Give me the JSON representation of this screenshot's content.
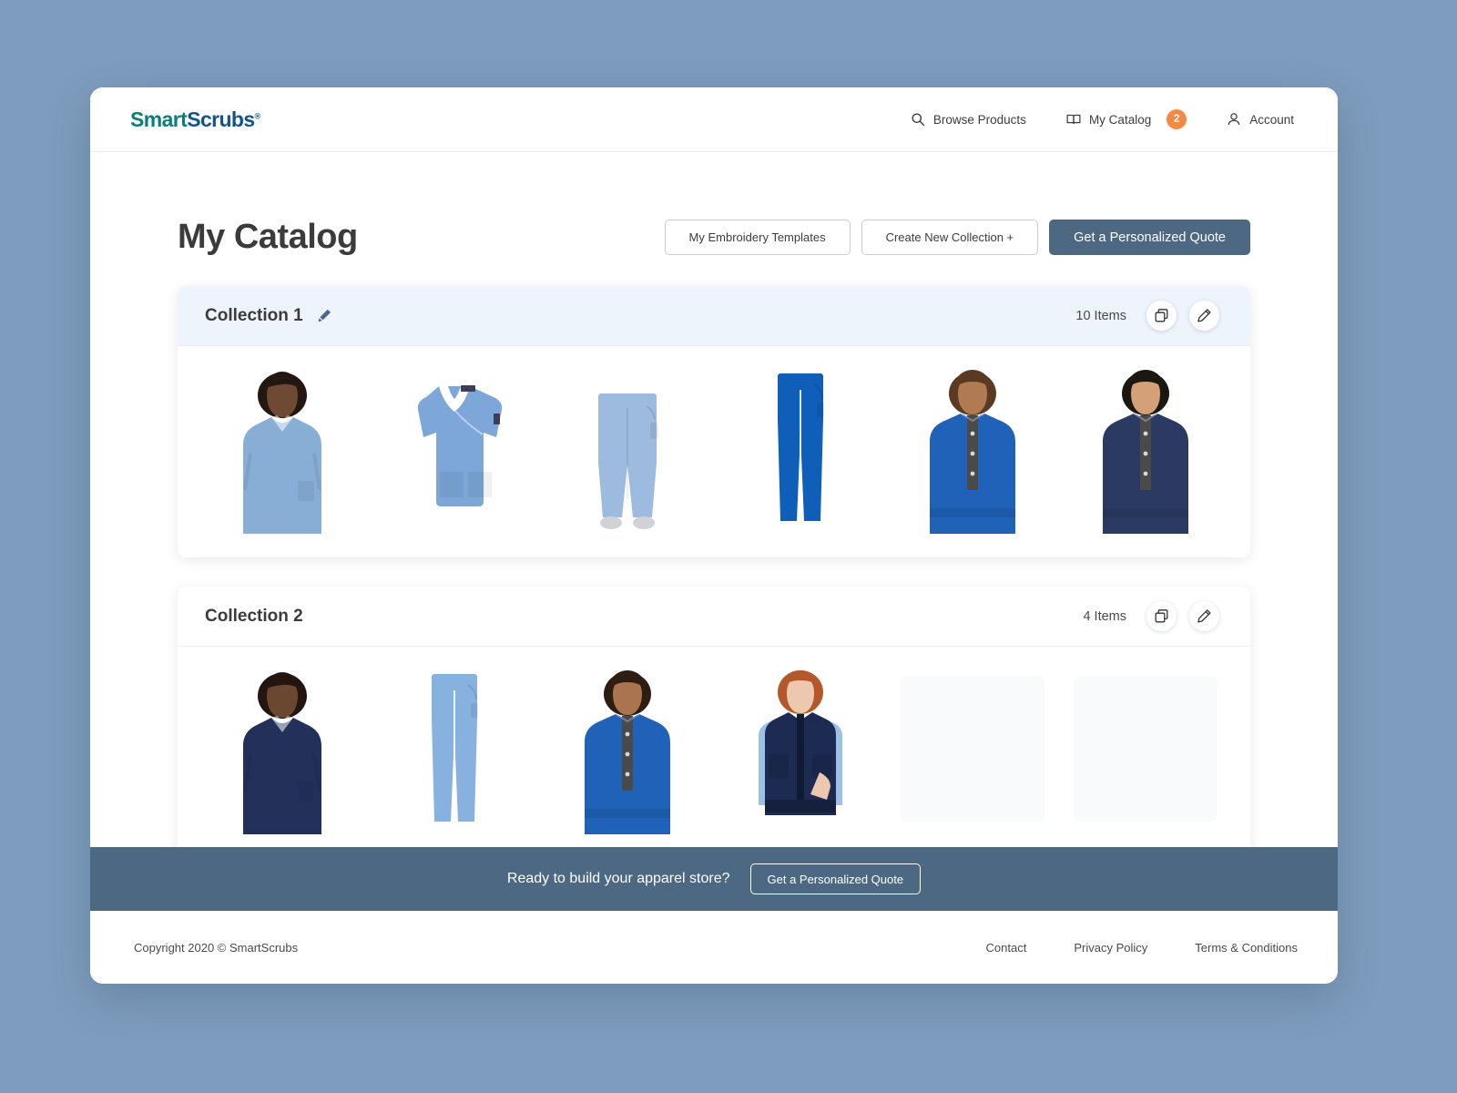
{
  "brand": {
    "name_part1": "Smart",
    "name_part2": "Scrubs",
    "trademark": "®",
    "color_teal": "#0a7f7a",
    "color_blue": "#14528f"
  },
  "nav": {
    "items": [
      {
        "label": "Browse Products",
        "icon": "search-icon"
      },
      {
        "label": "My Catalog",
        "icon": "catalog-icon",
        "badge": "2"
      },
      {
        "label": "Account",
        "icon": "user-icon"
      }
    ]
  },
  "header": {
    "title": "My Catalog",
    "buttons": {
      "embroidery": "My Embroidery Templates",
      "create_collection": "Create New Collection +",
      "quote": "Get a Personalized Quote"
    }
  },
  "collections": [
    {
      "title": "Collection 1",
      "count_label": "10 Items",
      "has_title_edit": true,
      "header_tinted": true,
      "items": [
        {
          "name": "model-ciel-scrub-top",
          "type": "model-top",
          "color": "#89aed6",
          "skin": "#6e4a35",
          "hair": "#241712"
        },
        {
          "name": "ciel-mock-wrap-top",
          "type": "flat-top",
          "color": "#7da7d9"
        },
        {
          "name": "model-ciel-scrub-pants",
          "type": "model-pants",
          "color": "#9dbbde",
          "skin": "#e7cbb4"
        },
        {
          "name": "royal-blue-scrub-pants",
          "type": "flat-pants",
          "color": "#0f5fb8"
        },
        {
          "name": "model-royal-warmup-jacket",
          "type": "model-jacket",
          "color": "#1f62b8",
          "skin": "#b07a52",
          "hair": "#5a3a22"
        },
        {
          "name": "model-navy-warmup-jacket",
          "type": "model-jacket",
          "color": "#2b3a63",
          "skin": "#d3a077",
          "hair": "#1d1711"
        }
      ]
    },
    {
      "title": "Collection 2",
      "count_label": "4 Items",
      "has_title_edit": false,
      "header_tinted": false,
      "items": [
        {
          "name": "model-navy-scrub-top",
          "type": "model-top",
          "color": "#23305a",
          "skin": "#6b4631",
          "hair": "#231610"
        },
        {
          "name": "ciel-flare-scrub-pants",
          "type": "flat-pants",
          "color": "#87b2e0"
        },
        {
          "name": "model-royal-warmup-jacket",
          "type": "model-jacket",
          "color": "#1f62b8",
          "skin": "#a9744e",
          "hair": "#2e1d12"
        },
        {
          "name": "model-navy-vest",
          "type": "model-vest",
          "color": "#1d2b52",
          "skin": "#ecc9ae",
          "hair": "#b4572a",
          "inner": "#9cc0e6"
        },
        {
          "name": "empty-slot",
          "type": "placeholder"
        },
        {
          "name": "empty-slot",
          "type": "placeholder"
        }
      ]
    }
  ],
  "cta": {
    "text": "Ready to build your apparel store?",
    "button": "Get a Personalized Quote"
  },
  "footer": {
    "copyright": "Copyright 2020 © SmartScrubs",
    "links": [
      "Contact",
      "Privacy Policy",
      "Terms & Conditions"
    ]
  },
  "theme": {
    "page_background": "#7e9cbd",
    "accent_slate": "#4c6883",
    "badge_orange": "#f58a44",
    "collection_header_tint": "#eef4fc",
    "placeholder_gray": "#f9fafb"
  }
}
